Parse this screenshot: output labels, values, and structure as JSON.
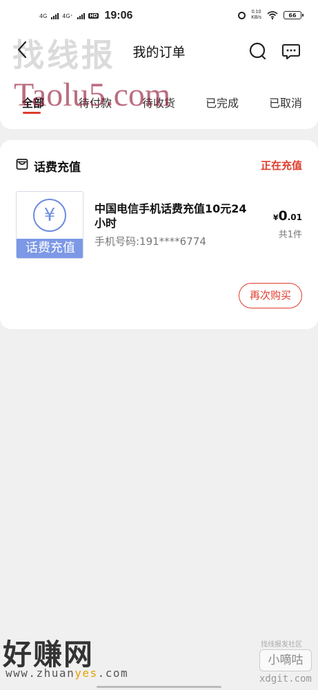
{
  "status_bar": {
    "net1": "4G",
    "net2": "4G⁺",
    "hd": "HD",
    "time": "19:06",
    "speed_value": "0.10",
    "speed_unit": "KB/s",
    "battery": "66"
  },
  "header": {
    "title": "我的订单"
  },
  "tabs": [
    {
      "label": "全部"
    },
    {
      "label": "待付款"
    },
    {
      "label": "待收货"
    },
    {
      "label": "已完成"
    },
    {
      "label": "已取消"
    }
  ],
  "order": {
    "shop_name": "话费充值",
    "status": "正在充值",
    "thumb_label": "话费充值",
    "thumb_symbol": "¥",
    "product_name": "中国电信手机话费充值10元24小时",
    "phone": "手机号码:191****6774",
    "price_currency": "¥",
    "price_int": "0",
    "price_dec": ".01",
    "quantity": "共1件",
    "rebuy_label": "再次购买"
  },
  "watermarks": {
    "top_cn": "找线报",
    "top_en": "Taolu5.com",
    "bottom_cn": "好赚网",
    "bottom_url_a": "www.zhuan",
    "bottom_url_b": "yes",
    "bottom_url_c": ".com",
    "corner_small": "找线报发社区",
    "corner_box": "小嘀咕",
    "corner_url": "xdgit.com"
  },
  "colors": {
    "accent": "#e03b2b",
    "thumb_blue": "#7c98e6"
  }
}
